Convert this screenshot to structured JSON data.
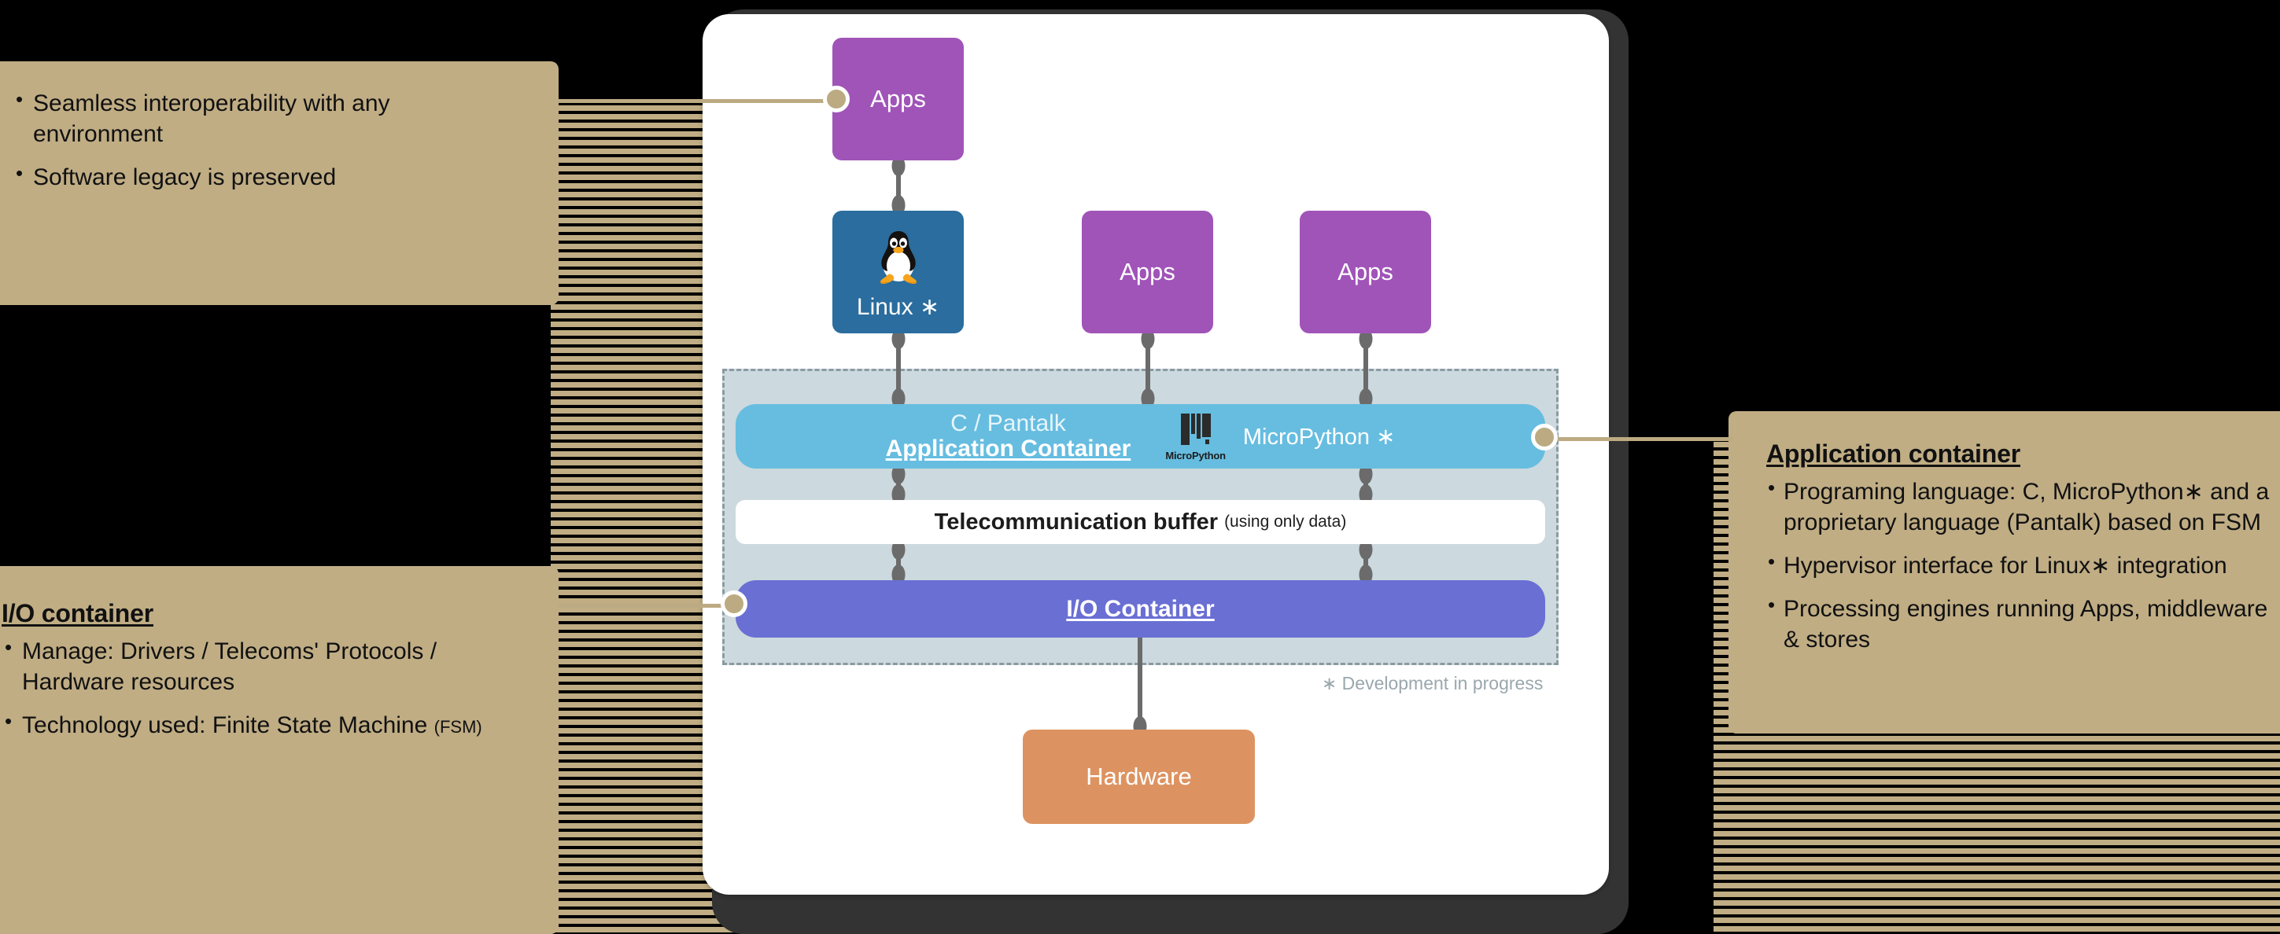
{
  "panels": {
    "top_left": {
      "bullets": [
        "Seamless interoperability with any environment",
        "Software legacy is preserved"
      ]
    },
    "bottom_left": {
      "title": "I/O container",
      "bullets": [
        "Manage: Drivers / Telecoms' Protocols / Hardware resources",
        "Technology used: Finite State Machine "
      ],
      "fsm_note": "(FSM)"
    },
    "right": {
      "title": "Application container",
      "bullets": [
        "Programing language: C, MicroPython∗ and a proprietary language (Pantalk) based on FSM",
        "Hypervisor interface for Linux∗ integration",
        "Processing engines running Apps, middleware & stores"
      ]
    }
  },
  "diagram": {
    "apps_top_label": "Apps",
    "apps_mid_label": "Apps",
    "apps_right_label": "Apps",
    "linux_label": "Linux ∗",
    "app_container_line1": "C / Pantalk",
    "app_container_line2": "Application Container",
    "micropython_logo_name": "MicroPython",
    "micropython_label": "MicroPython ∗",
    "telecom_title": "Telecommunication buffer",
    "telecom_suffix": "(using only data)",
    "io_container_label": "I/O Container",
    "hardware_label": "Hardware",
    "development_note": "∗ Development in progress"
  },
  "colors": {
    "panel_bg": "#c0ad84",
    "apps": "#a054b8",
    "linux": "#2a6d9e",
    "app_container": "#66bde0",
    "io_container": "#6a6fd4",
    "hardware": "#dd9361",
    "dashed_container": "#ccd9de",
    "leader": "#bcaa82",
    "connector": "#6b6b6b",
    "device_frame": "#333333"
  }
}
